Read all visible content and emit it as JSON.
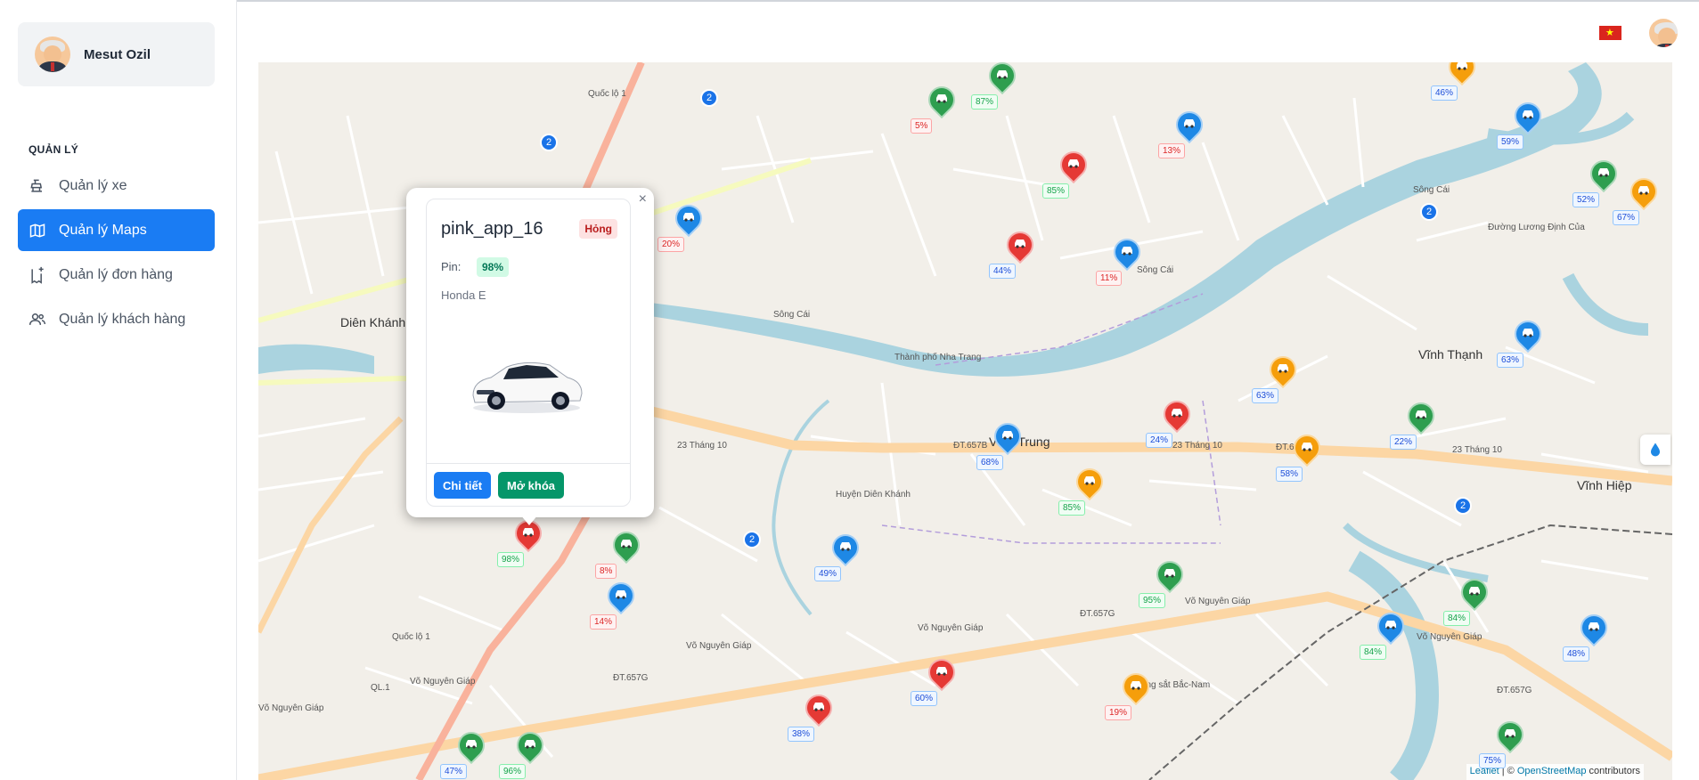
{
  "user": {
    "name": "Mesut Ozil"
  },
  "sidebar": {
    "section_label": "QUẢN LÝ",
    "items": [
      {
        "label": "Quản lý xe",
        "icon": "car-seat-icon",
        "active": false
      },
      {
        "label": "Quản lý Maps",
        "icon": "map-icon",
        "active": true
      },
      {
        "label": "Quản lý đơn hàng",
        "icon": "order-icon",
        "active": false
      },
      {
        "label": "Quản lý khách hàng",
        "icon": "users-icon",
        "active": false
      }
    ]
  },
  "header": {
    "language_flag": "vietnam-flag",
    "flag_star": "★"
  },
  "map": {
    "places": [
      "Diên Khánh",
      "Vĩnh Trung",
      "Vĩnh Thạnh",
      "Vĩnh Hiệp"
    ],
    "road_labels": [
      "23 Tháng 10",
      "23 Tháng 10",
      "23 Tháng 10",
      "Võ Nguyên Giáp",
      "Võ Nguyên Giáp",
      "Võ Nguyên Giáp",
      "Võ Nguyên Giáp",
      "Võ Nguyên Giáp",
      "Võ Nguyên Giáp",
      "ĐT.657B",
      "ĐT.657B",
      "ĐT.657G",
      "ĐT.657G",
      "ĐT.657G",
      "QL.1",
      "Quốc lộ 1",
      "Quốc lộ 1",
      "Sông Cái",
      "Sông Cái",
      "Sông Cái",
      "Đường Lương Định Của",
      "Đường sắt Bắc-Nam",
      "Huyện Diên Khánh",
      "Thành phố Nha Trang"
    ],
    "clusters": [
      "2",
      "2",
      "2",
      "2",
      "2"
    ],
    "markers": [
      {
        "color": "green",
        "badge": "87%",
        "badge_color": "green"
      },
      {
        "color": "green",
        "badge": "5%",
        "badge_color": "red"
      },
      {
        "color": "blue",
        "badge": "13%",
        "badge_color": "red"
      },
      {
        "color": "orange",
        "badge": "46%",
        "badge_color": "blue"
      },
      {
        "color": "blue",
        "badge": "59%",
        "badge_color": "blue"
      },
      {
        "color": "green",
        "badge": "52%",
        "badge_color": "blue"
      },
      {
        "color": "orange",
        "badge": "67%",
        "badge_color": "blue"
      },
      {
        "color": "red",
        "badge": "85%",
        "badge_color": "green"
      },
      {
        "color": "red",
        "badge": "44%",
        "badge_color": "blue"
      },
      {
        "color": "blue",
        "badge": "11%",
        "badge_color": "red"
      },
      {
        "color": "blue",
        "badge": "20%",
        "badge_color": "red"
      },
      {
        "color": "blue",
        "badge": "63%",
        "badge_color": "blue"
      },
      {
        "color": "orange",
        "badge": "63%",
        "badge_color": "blue"
      },
      {
        "color": "red",
        "badge": "24%",
        "badge_color": "blue"
      },
      {
        "color": "blue",
        "badge": "68%",
        "badge_color": "blue"
      },
      {
        "color": "orange",
        "badge": "85%",
        "badge_color": "green"
      },
      {
        "color": "orange",
        "badge": "58%",
        "badge_color": "blue"
      },
      {
        "color": "green",
        "badge": "22%",
        "badge_color": "blue"
      },
      {
        "color": "red",
        "badge": "98%",
        "badge_color": "green"
      },
      {
        "color": "green",
        "badge": "8%",
        "badge_color": "red"
      },
      {
        "color": "blue",
        "badge": "14%",
        "badge_color": "red"
      },
      {
        "color": "blue",
        "badge": "49%",
        "badge_color": "blue"
      },
      {
        "color": "green",
        "badge": "95%",
        "badge_color": "green"
      },
      {
        "color": "green",
        "badge": "84%",
        "badge_color": "green"
      },
      {
        "color": "blue",
        "badge": "84%",
        "badge_color": "green"
      },
      {
        "color": "blue",
        "badge": "48%",
        "badge_color": "blue"
      },
      {
        "color": "red",
        "badge": "60%",
        "badge_color": "blue"
      },
      {
        "color": "orange",
        "badge": "19%",
        "badge_color": "red"
      },
      {
        "color": "red",
        "badge": "38%",
        "badge_color": "blue"
      },
      {
        "color": "green",
        "badge": "47%",
        "badge_color": "blue"
      },
      {
        "color": "green",
        "badge": "96%",
        "badge_color": "green"
      },
      {
        "color": "green",
        "badge": "75%",
        "badge_color": "blue"
      }
    ],
    "attribution": {
      "leaflet": "Leaflet",
      "separator": " | © ",
      "osm": "OpenStreetMap",
      "suffix": " contributors"
    }
  },
  "popup": {
    "close": "×",
    "vehicle_name": "pink_app_16",
    "status": "Hỏng",
    "battery_label": "Pin:",
    "battery_value": "98%",
    "model": "Honda E",
    "detail_button": "Chi tiết",
    "unlock_button": "Mở khóa"
  },
  "colors": {
    "primary": "#1a7cf3",
    "unlock": "#059669",
    "marker_green": "#2e9e4f",
    "marker_red": "#e53935",
    "marker_blue": "#1e88e5",
    "marker_orange": "#f59e0b"
  }
}
